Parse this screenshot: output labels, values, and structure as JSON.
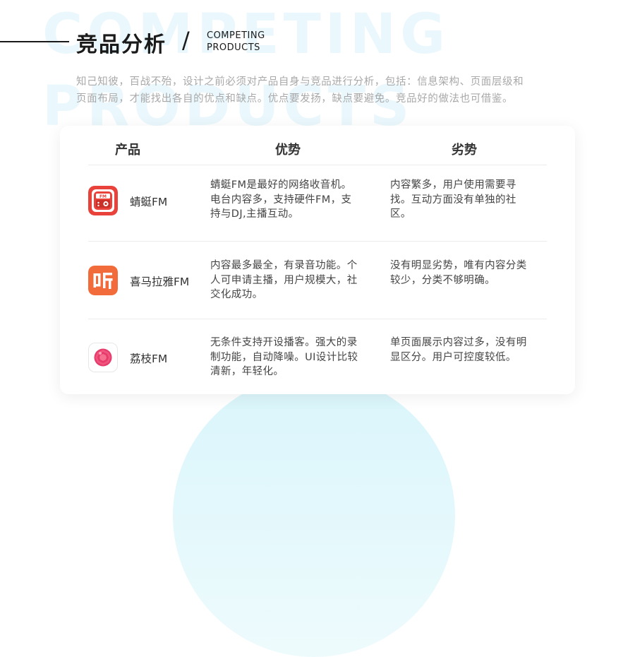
{
  "header": {
    "title": "竞品分析",
    "slash": "/",
    "subtitle_lines": [
      "COMPETING",
      "PRODUCTS"
    ],
    "bg_words": [
      "COMPETING",
      "PRODUCTS"
    ]
  },
  "intro": {
    "lines": [
      "知己知彼，百战不殆，设计之前必须对产品自身与竞品进行分析，包括：信息架构、页面层级和",
      "页面布局，才能找出各自的优点和缺点。优点要发扬，缺点要避免。竞品好的做法也可借鉴。"
    ]
  },
  "table": {
    "headers": [
      "产品",
      "优势",
      "劣势"
    ],
    "rows": [
      {
        "name": "蜻蜓FM",
        "icon": "qingting-fm-radio-icon",
        "icon_color": "#e8423b",
        "icon_text": "FM",
        "pros": [
          "蜻蜓FM是最好的网络收音机。",
          "电台内容多，支持硬件FM，支",
          "持与DJ,主播互动。"
        ],
        "cons": [
          "内容繁多，用户使用需要寻",
          "找。互动方面没有单独的社",
          "区。"
        ]
      },
      {
        "name": "喜马拉雅FM",
        "icon": "ximalaya-ting-icon",
        "icon_color": "#f26b3a",
        "icon_text": "听",
        "pros": [
          "内容最多最全，有录音功能。个",
          "人可申请主播，用户规模大，社",
          "交化成功。"
        ],
        "cons": [
          "没有明显劣势，唯有内容分类",
          "较少，分类不够明确。"
        ]
      },
      {
        "name": "荔枝FM",
        "icon": "lizhi-fm-lychee-icon",
        "icon_color": "#e63b6b",
        "pros": [
          "无条件支持开设播客。强大的录",
          "制功能，自动降噪。UI设计比较",
          "清新，年轻化。"
        ],
        "cons": [
          "单页面展示内容过多，没有明",
          "显区分。用户可控度较低。"
        ]
      }
    ]
  },
  "colors": {
    "accent_bg": "#eaf8fd",
    "text": "#333333",
    "intro": "#a8a8a8"
  }
}
